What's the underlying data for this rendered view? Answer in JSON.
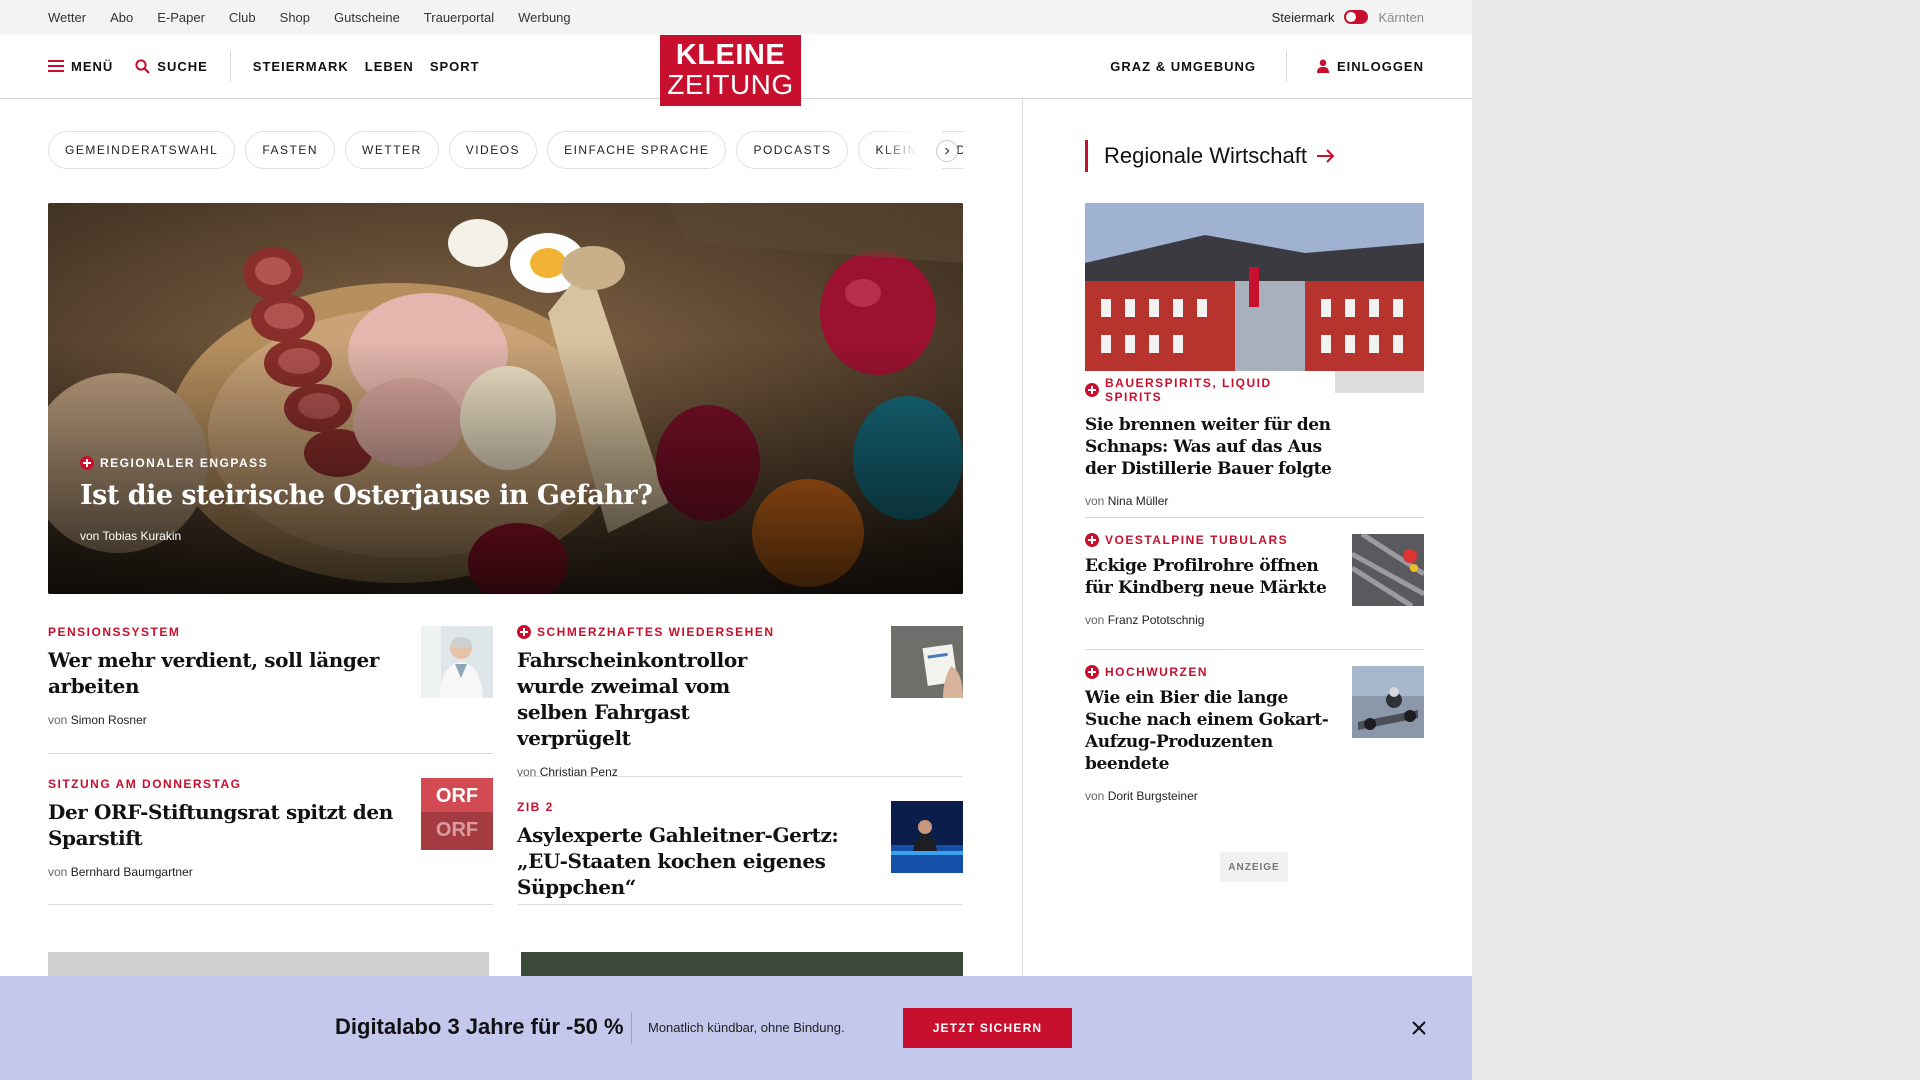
{
  "topbar": {
    "links": [
      "Wetter",
      "Abo",
      "E-Paper",
      "Club",
      "Shop",
      "Gutscheine",
      "Trauerportal",
      "Werbung"
    ],
    "region_active": "Steiermark",
    "region_inactive": "Kärnten"
  },
  "header": {
    "menu_label": "MENÜ",
    "search_label": "SUCHE",
    "sections": [
      "STEIERMARK",
      "LEBEN",
      "SPORT"
    ],
    "logo_line1": "KLEINE",
    "logo_line2": "ZEITUNG",
    "local_label": "GRAZ & UMGEBUNG",
    "login_label": "EINLOGGEN"
  },
  "topics": [
    "GEMEINDERATSWAHL",
    "FASTEN",
    "WETTER",
    "VIDEOS",
    "EINFACHE SPRACHE",
    "PODCASTS",
    "KLEINE KINDER"
  ],
  "hero": {
    "kicker": "REGIONALER ENGPASS",
    "title": "Ist die steirische Osterjause in Gefahr?",
    "author_prefix": "von",
    "author": "Tobias Kurakin"
  },
  "articles": [
    {
      "kicker": "PENSIONSSYSTEM",
      "premium": false,
      "title": "Wer mehr verdient, soll länger arbeiten",
      "author_prefix": "von",
      "author": "Simon Rosner"
    },
    {
      "kicker": "SCHMERZHAFTES WIEDERSEHEN",
      "premium": true,
      "title": "Fahrscheinkontrollor wurde zweimal vom selben Fahrgast verprügelt",
      "author_prefix": "von",
      "author": "Christian Penz"
    },
    {
      "kicker": "SITZUNG AM DONNERSTAG",
      "premium": false,
      "title": "Der ORF-Stiftungsrat spitzt den Sparstift",
      "author_prefix": "von",
      "author": "Bernhard Baumgartner",
      "thumb_text": "ORF"
    },
    {
      "kicker": "ZIB 2",
      "premium": false,
      "title": "Asylexperte Gahleitner-Gertz: „EU-Staaten kochen eigenes Süppchen“"
    }
  ],
  "sidebar": {
    "heading": "Regionale Wirtschaft",
    "articles": [
      {
        "kicker": "BAUERSPIRITS, LIQUID SPIRITS",
        "title": "Sie brennen weiter für den Schnaps: Was auf das Aus der Distillerie Bauer folgte",
        "author_prefix": "von",
        "author": "Nina Müller"
      },
      {
        "kicker": "VOESTALPINE TUBULARS",
        "title": "Eckige Profilrohre öffnen für Kindberg neue Märkte",
        "author_prefix": "von",
        "author": "Franz Pototschnig"
      },
      {
        "kicker": "HOCHWURZEN",
        "title": "Wie ein Bier die lange Suche nach einem Gokart-Aufzug-Produzenten beendete",
        "author_prefix": "von",
        "author": "Dorit Burgsteiner"
      }
    ],
    "ad_label": "ANZEIGE"
  },
  "banner": {
    "title": "Digitalabo 3 Jahre für -50 %",
    "subtitle": "Monatlich kündbar, ohne Bindung.",
    "button": "JETZT SICHERN"
  },
  "colors": {
    "brand_red": "#c8102e",
    "banner_bg": "#c3c8ec"
  },
  "icons": [
    "hamburger-menu-icon",
    "search-icon",
    "user-icon",
    "arrow-right-icon",
    "chevron-right-icon",
    "plus-badge-icon",
    "close-icon"
  ]
}
